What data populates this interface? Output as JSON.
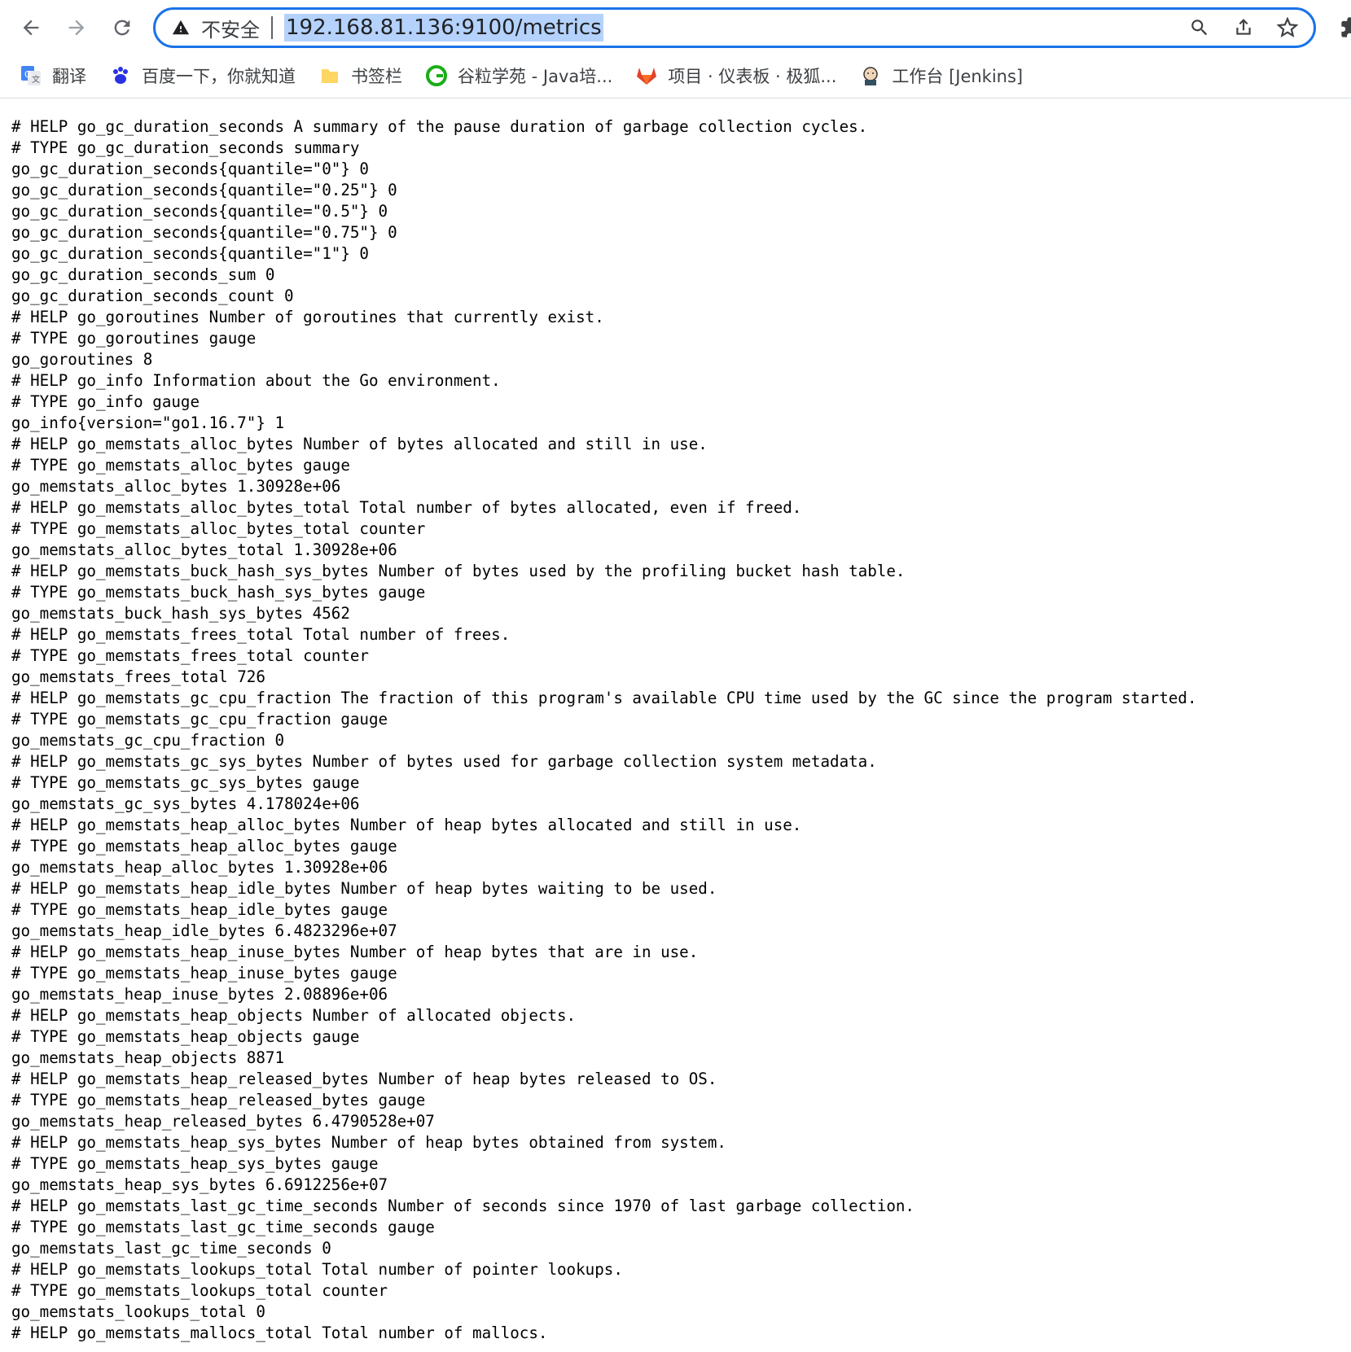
{
  "browser": {
    "security_label": "不安全",
    "url": "192.168.81.136:9100/metrics"
  },
  "icons": {
    "back": "arrow-left-icon",
    "forward": "arrow-right-icon",
    "reload": "reload-icon",
    "warning": "warning-triangle-icon",
    "search": "search-icon",
    "share": "share-icon",
    "star": "star-icon",
    "extension": "puzzle-icon"
  },
  "bookmarks": [
    {
      "label": "翻译",
      "icon": "google-translate-icon"
    },
    {
      "label": "百度一下，你就知道",
      "icon": "baidu-paw-icon"
    },
    {
      "label": "书签栏",
      "icon": "folder-icon"
    },
    {
      "label": "谷粒学苑 - Java培...",
      "icon": "guli-logo-icon"
    },
    {
      "label": "项目 · 仪表板 · 极狐...",
      "icon": "gitlab-fox-icon"
    },
    {
      "label": "工作台 [Jenkins]",
      "icon": "jenkins-icon"
    }
  ],
  "metrics_lines": [
    "# HELP go_gc_duration_seconds A summary of the pause duration of garbage collection cycles.",
    "# TYPE go_gc_duration_seconds summary",
    "go_gc_duration_seconds{quantile=\"0\"} 0",
    "go_gc_duration_seconds{quantile=\"0.25\"} 0",
    "go_gc_duration_seconds{quantile=\"0.5\"} 0",
    "go_gc_duration_seconds{quantile=\"0.75\"} 0",
    "go_gc_duration_seconds{quantile=\"1\"} 0",
    "go_gc_duration_seconds_sum 0",
    "go_gc_duration_seconds_count 0",
    "# HELP go_goroutines Number of goroutines that currently exist.",
    "# TYPE go_goroutines gauge",
    "go_goroutines 8",
    "# HELP go_info Information about the Go environment.",
    "# TYPE go_info gauge",
    "go_info{version=\"go1.16.7\"} 1",
    "# HELP go_memstats_alloc_bytes Number of bytes allocated and still in use.",
    "# TYPE go_memstats_alloc_bytes gauge",
    "go_memstats_alloc_bytes 1.30928e+06",
    "# HELP go_memstats_alloc_bytes_total Total number of bytes allocated, even if freed.",
    "# TYPE go_memstats_alloc_bytes_total counter",
    "go_memstats_alloc_bytes_total 1.30928e+06",
    "# HELP go_memstats_buck_hash_sys_bytes Number of bytes used by the profiling bucket hash table.",
    "# TYPE go_memstats_buck_hash_sys_bytes gauge",
    "go_memstats_buck_hash_sys_bytes 4562",
    "# HELP go_memstats_frees_total Total number of frees.",
    "# TYPE go_memstats_frees_total counter",
    "go_memstats_frees_total 726",
    "# HELP go_memstats_gc_cpu_fraction The fraction of this program's available CPU time used by the GC since the program started.",
    "# TYPE go_memstats_gc_cpu_fraction gauge",
    "go_memstats_gc_cpu_fraction 0",
    "# HELP go_memstats_gc_sys_bytes Number of bytes used for garbage collection system metadata.",
    "# TYPE go_memstats_gc_sys_bytes gauge",
    "go_memstats_gc_sys_bytes 4.178024e+06",
    "# HELP go_memstats_heap_alloc_bytes Number of heap bytes allocated and still in use.",
    "# TYPE go_memstats_heap_alloc_bytes gauge",
    "go_memstats_heap_alloc_bytes 1.30928e+06",
    "# HELP go_memstats_heap_idle_bytes Number of heap bytes waiting to be used.",
    "# TYPE go_memstats_heap_idle_bytes gauge",
    "go_memstats_heap_idle_bytes 6.4823296e+07",
    "# HELP go_memstats_heap_inuse_bytes Number of heap bytes that are in use.",
    "# TYPE go_memstats_heap_inuse_bytes gauge",
    "go_memstats_heap_inuse_bytes 2.08896e+06",
    "# HELP go_memstats_heap_objects Number of allocated objects.",
    "# TYPE go_memstats_heap_objects gauge",
    "go_memstats_heap_objects 8871",
    "# HELP go_memstats_heap_released_bytes Number of heap bytes released to OS.",
    "# TYPE go_memstats_heap_released_bytes gauge",
    "go_memstats_heap_released_bytes 6.4790528e+07",
    "# HELP go_memstats_heap_sys_bytes Number of heap bytes obtained from system.",
    "# TYPE go_memstats_heap_sys_bytes gauge",
    "go_memstats_heap_sys_bytes 6.6912256e+07",
    "# HELP go_memstats_last_gc_time_seconds Number of seconds since 1970 of last garbage collection.",
    "# TYPE go_memstats_last_gc_time_seconds gauge",
    "go_memstats_last_gc_time_seconds 0",
    "# HELP go_memstats_lookups_total Total number of pointer lookups.",
    "# TYPE go_memstats_lookups_total counter",
    "go_memstats_lookups_total 0",
    "# HELP go_memstats_mallocs_total Total number of mallocs."
  ]
}
